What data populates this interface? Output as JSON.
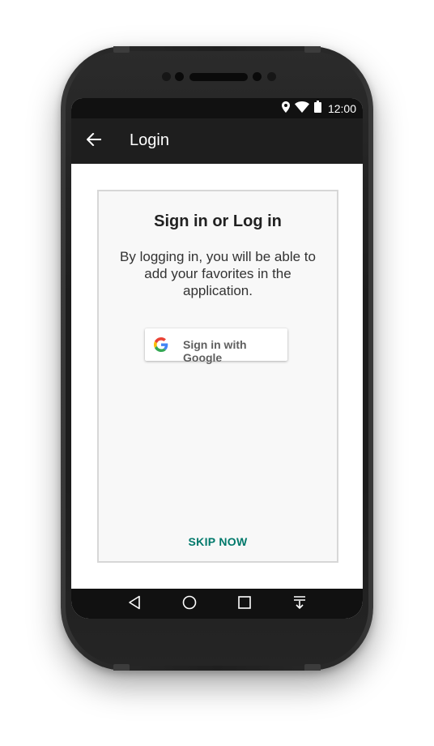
{
  "status_bar": {
    "time": "12:00",
    "icons": [
      "location-icon",
      "wifi-icon",
      "battery-icon"
    ]
  },
  "app_bar": {
    "back_icon": "arrow-left-icon",
    "title": "Login"
  },
  "card": {
    "title": "Sign in or Log in",
    "description": "By logging in, you will be able to add your favorites in the application.",
    "google_button": {
      "icon": "google-logo-icon",
      "label": "Sign in with Google"
    },
    "skip_label": "SKIP NOW"
  },
  "nav_bar": {
    "items": [
      "back-triangle-icon",
      "home-circle-icon",
      "recents-square-icon",
      "notifications-pull-icon"
    ]
  },
  "colors": {
    "app_bar": "#1e1e1e",
    "status_bar": "#111111",
    "accent": "#00796b",
    "card_bg": "#f8f8f8",
    "card_border": "#d7d7d7",
    "google_blue": "#4285F4",
    "google_red": "#EA4335",
    "google_yellow": "#FBBC05",
    "google_green": "#34A853"
  }
}
